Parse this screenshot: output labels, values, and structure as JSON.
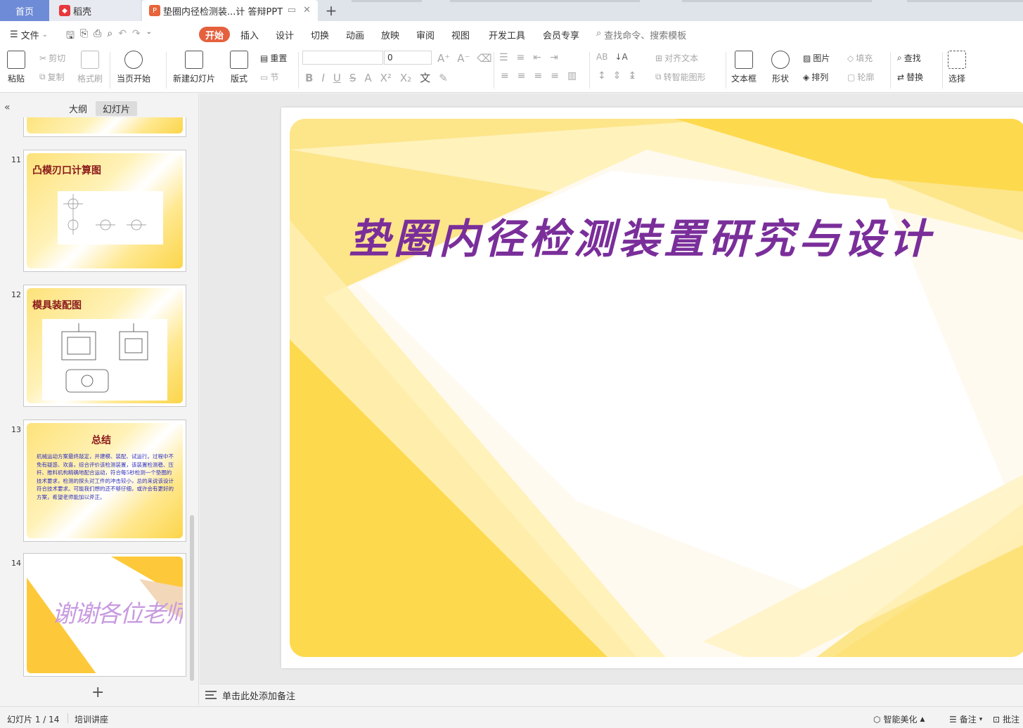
{
  "tabs": {
    "home": "首页",
    "daoke": "稻壳",
    "document": "垫圈内径检测装...计 答辩PPT",
    "new_tab": "+"
  },
  "menu": {
    "file": "文件",
    "items": [
      "开始",
      "插入",
      "设计",
      "切换",
      "动画",
      "放映",
      "审阅",
      "视图",
      "开发工具",
      "会员专享"
    ],
    "active": "开始",
    "search_placeholder": "查找命令、搜索模板"
  },
  "ribbon": {
    "paste": "粘贴",
    "cut": "剪切",
    "copy": "复制",
    "format_painter": "格式刷",
    "play_from_current": "当页开始",
    "new_slide": "新建幻灯片",
    "layout": "版式",
    "reset": "重置",
    "section": "节",
    "font_size_value": "0",
    "align_text": "对齐文本",
    "smart_shape": "转智能图形",
    "text_box": "文本框",
    "shape": "形状",
    "picture": "图片",
    "arrange": "排列",
    "fill": "填充",
    "outline": "轮廓",
    "find": "查找",
    "replace": "替换",
    "select": "选择"
  },
  "panel": {
    "outline_tab": "大纲",
    "slides_tab": "幻灯片",
    "slides": [
      {
        "num": "11",
        "title": "凸模刃口计算图"
      },
      {
        "num": "12",
        "title": "模具装配图"
      },
      {
        "num": "13",
        "title": "总结",
        "body": "机械运动方案最终敲定，并建模、装配、试运行。过程中不免有疑惑、欢喜，综合评价该检测装置，该装置检测稳、压杆、推料机构精确地配合运动，符合每5秒检测一个垫圈的技术要求，检测的探头对工件的冲击较小，总的来说该设计符合技术要求。可能我们想的还不够仔细，或许会有更好的方案，希望老师能加以斧正。"
      },
      {
        "num": "14",
        "title": "谢谢各位老师！"
      }
    ]
  },
  "slide": {
    "title": "垫圈内径检测装置研究与设计"
  },
  "notes": {
    "placeholder": "单击此处添加备注"
  },
  "status": {
    "slide_counter": "幻灯片 1 / 14",
    "theme": "培训讲座",
    "beautify": "智能美化",
    "notes": "备注",
    "comments": "批注"
  },
  "colors": {
    "accent": "#e5603d",
    "home_tab": "#6d8bd6",
    "slide_title": "#7a2e9a",
    "thumb_title": "#8a1a1a",
    "slide_yellow": "#fdd94e"
  }
}
